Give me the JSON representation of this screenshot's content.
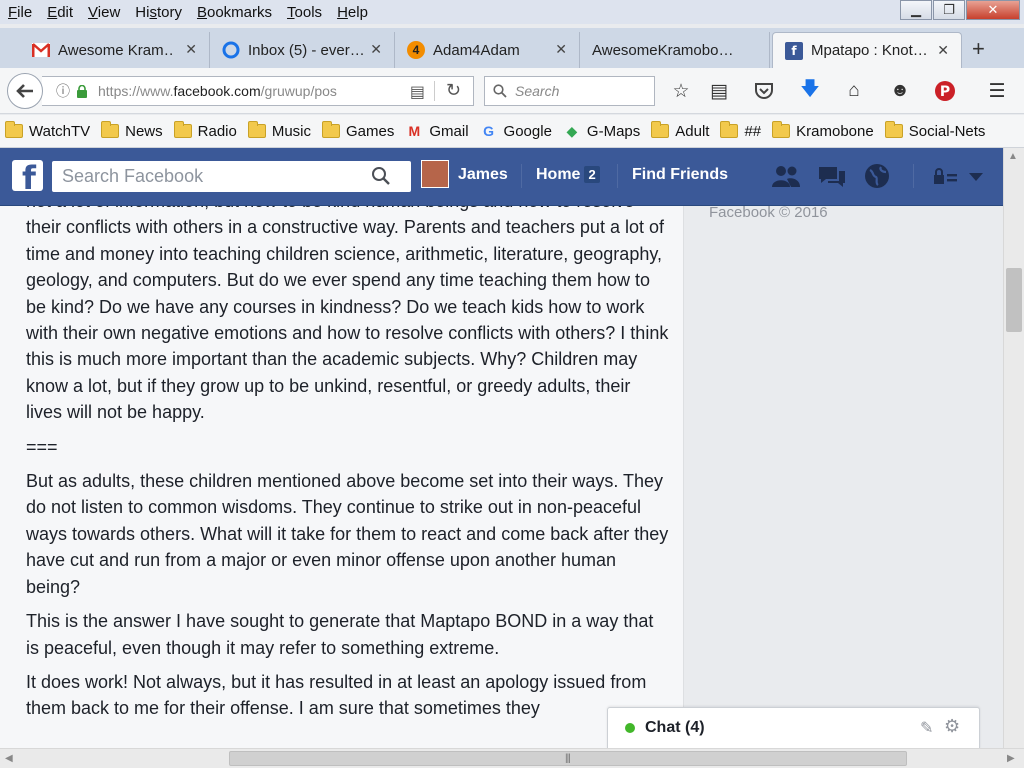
{
  "menubar": {
    "items": [
      {
        "u": "F",
        "rest": "ile"
      },
      {
        "u": "E",
        "rest": "dit"
      },
      {
        "u": "V",
        "rest": "iew"
      },
      {
        "pre": "Hi",
        "u": "s",
        "rest": "tory"
      },
      {
        "u": "B",
        "rest": "ookmarks"
      },
      {
        "u": "T",
        "rest": "ools"
      },
      {
        "u": "H",
        "rest": "elp"
      }
    ]
  },
  "tabs": [
    {
      "title": "Awesome Kram…",
      "icon": "gmail-icon"
    },
    {
      "title": "Inbox (5) - ever…",
      "icon": "inbox-icon"
    },
    {
      "title": "Adam4Adam",
      "icon": "adam4adam-icon"
    },
    {
      "title": "AwesomeKramobo…",
      "icon": "none"
    },
    {
      "title": "Mpatapo : Knot…",
      "icon": "facebook-icon"
    }
  ],
  "navbar": {
    "url_host": "https://www.",
    "url_domain": "facebook.com",
    "url_path": "/gruwup/pos",
    "search_placeholder": "Search"
  },
  "bookmarks": [
    {
      "label": "WatchTV",
      "icon": "folder-icon"
    },
    {
      "label": "News",
      "icon": "folder-icon"
    },
    {
      "label": "Radio",
      "icon": "folder-icon"
    },
    {
      "label": "Music",
      "icon": "folder-icon"
    },
    {
      "label": "Games",
      "icon": "folder-icon"
    },
    {
      "label": "Gmail",
      "icon": "gmail-icon"
    },
    {
      "label": "Google",
      "icon": "google-icon"
    },
    {
      "label": "G-Maps",
      "icon": "maps-icon"
    },
    {
      "label": "Adult",
      "icon": "folder-icon"
    },
    {
      "label": "##",
      "icon": "folder-icon"
    },
    {
      "label": "Kramobone",
      "icon": "folder-icon"
    },
    {
      "label": "Social-Nets",
      "icon": "folder-icon"
    }
  ],
  "facebook": {
    "search_placeholder": "Search Facebook",
    "user_name": "James",
    "home_label": "Home",
    "home_count": "2",
    "find_friends_label": "Find Friends",
    "copyright": "Facebook © 2016"
  },
  "post": {
    "paragraphs": [
      "not a lot of information, but how to be kind human beings and how to resolve their conflicts with others in a constructive way. Parents and teachers put a lot of time and money into teaching children science, arithmetic, literature, geography, geology, and computers. But do we ever spend any time teaching them how to be kind? Do we have any courses in kindness? Do we teach kids how to work with their own negative emotions and how to resolve conflicts with others? I think this is much more important than the academic subjects. Why? Children may know a lot, but if they grow up to be unkind, resentful, or greedy adults, their lives will not be happy.",
      "===",
      "But as adults, these children mentioned above become set into their ways. They do not listen to common wisdoms. They continue to strike out in non-peaceful ways towards others. What will it take for them to react and come back after they have cut and run from a major or even minor offense upon another human being?",
      "This is the answer I have sought to generate that Maptapo BOND in a way that is peaceful, even though it may refer to something extreme.",
      "It does work! Not always, but it has resulted in at least an apology issued from them back to me for their offense. I am sure that sometimes they"
    ]
  },
  "chat": {
    "label": "Chat (4)"
  }
}
